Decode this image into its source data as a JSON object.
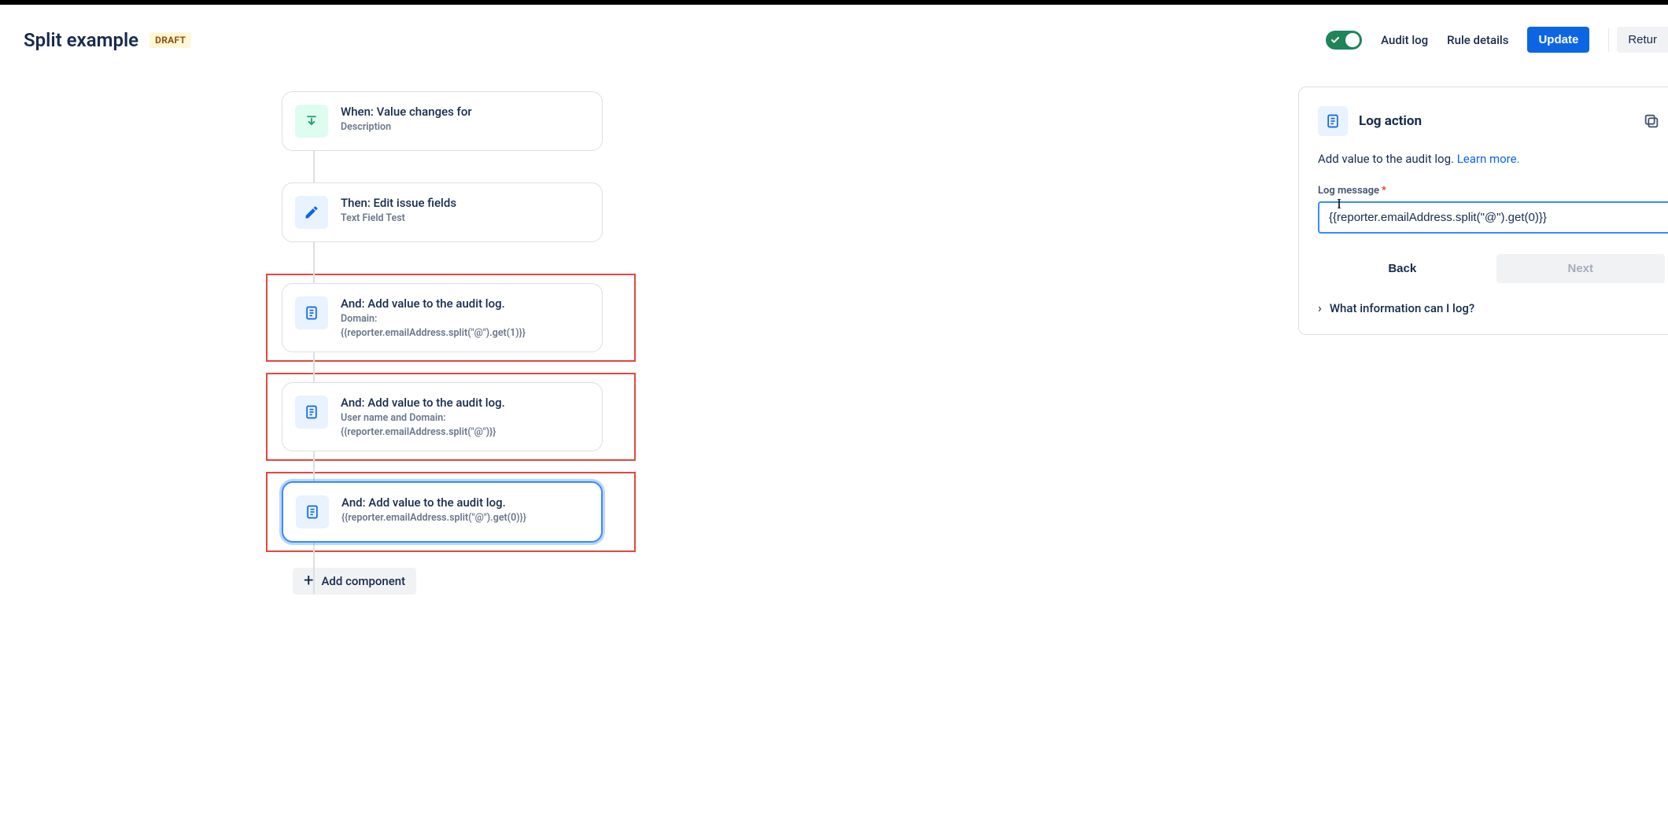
{
  "header": {
    "title": "Split example",
    "badge": "DRAFT",
    "audit_log": "Audit log",
    "rule_details": "Rule details",
    "update": "Update",
    "return": "Retur"
  },
  "nodes": {
    "when": {
      "title": "When: Value changes for",
      "sub": "Description"
    },
    "then": {
      "title": "Then: Edit issue fields",
      "sub": "Text Field Test"
    },
    "and1": {
      "title": "And: Add value to the audit log.",
      "sub": "Domain:",
      "sub2": "{{reporter.emailAddress.split(\"@\").get(1)}}"
    },
    "and2": {
      "title": "And: Add value to the audit log.",
      "sub": "User name and Domain:",
      "sub2": "{{reporter.emailAddress.split(\"@\")}}"
    },
    "and3": {
      "title": "And: Add value to the audit log.",
      "sub": "{{reporter.emailAddress.split(\"@\").get(0)}}"
    },
    "add_component": "Add component"
  },
  "panel": {
    "title": "Log action",
    "desc_prefix": "Add value to the audit log. ",
    "learn_more": "Learn more.",
    "field_label": "Log message",
    "field_value": "{{reporter.emailAddress.split(\"@\").get(0)}}",
    "back": "Back",
    "next": "Next",
    "expander": "What information can I log?"
  }
}
